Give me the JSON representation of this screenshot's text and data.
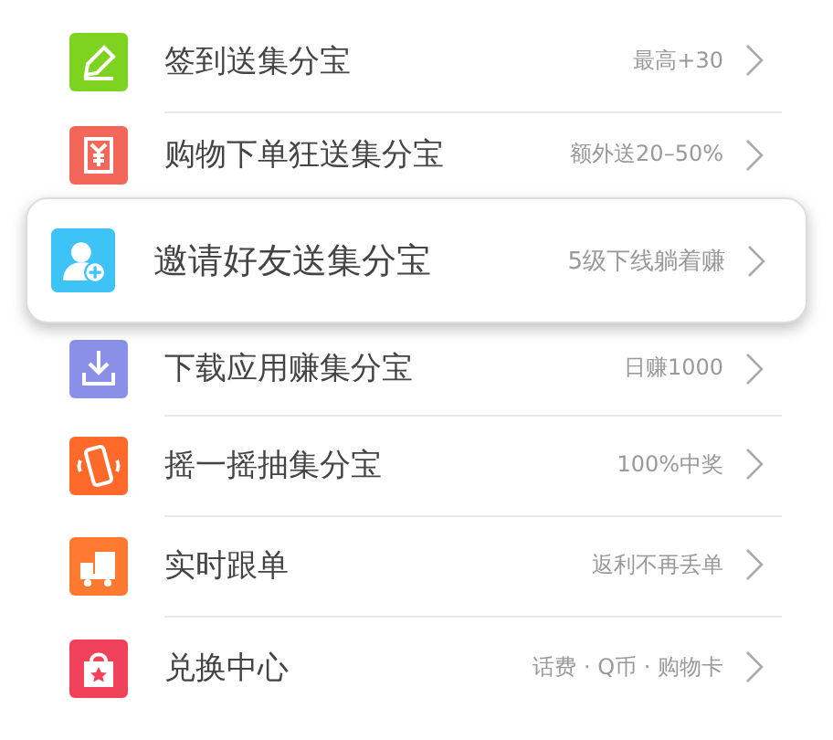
{
  "items": [
    {
      "title": "签到送集分宝",
      "note": "最高+30",
      "color": "#7ed321",
      "selected": false
    },
    {
      "title": "购物下单狂送集分宝",
      "note": "额外送20–50%",
      "color": "#f2675a",
      "selected": false
    },
    {
      "title": "邀请好友送集分宝",
      "note": "5级下线躺着赚",
      "color": "#3ec3f7",
      "selected": true
    },
    {
      "title": "下载应用赚集分宝",
      "note": "日赚1000",
      "color": "#8a8fe8",
      "selected": false
    },
    {
      "title": "摇一摇抽集分宝",
      "note": "100%中奖",
      "color": "#ff6a2a",
      "selected": false
    },
    {
      "title": "实时跟单",
      "note": "返利不再丢单",
      "color": "#ff7a30",
      "selected": false
    },
    {
      "title": "兑换中心",
      "note": "话费 · Q币 · 购物卡",
      "color": "#f0425a",
      "selected": false
    }
  ]
}
